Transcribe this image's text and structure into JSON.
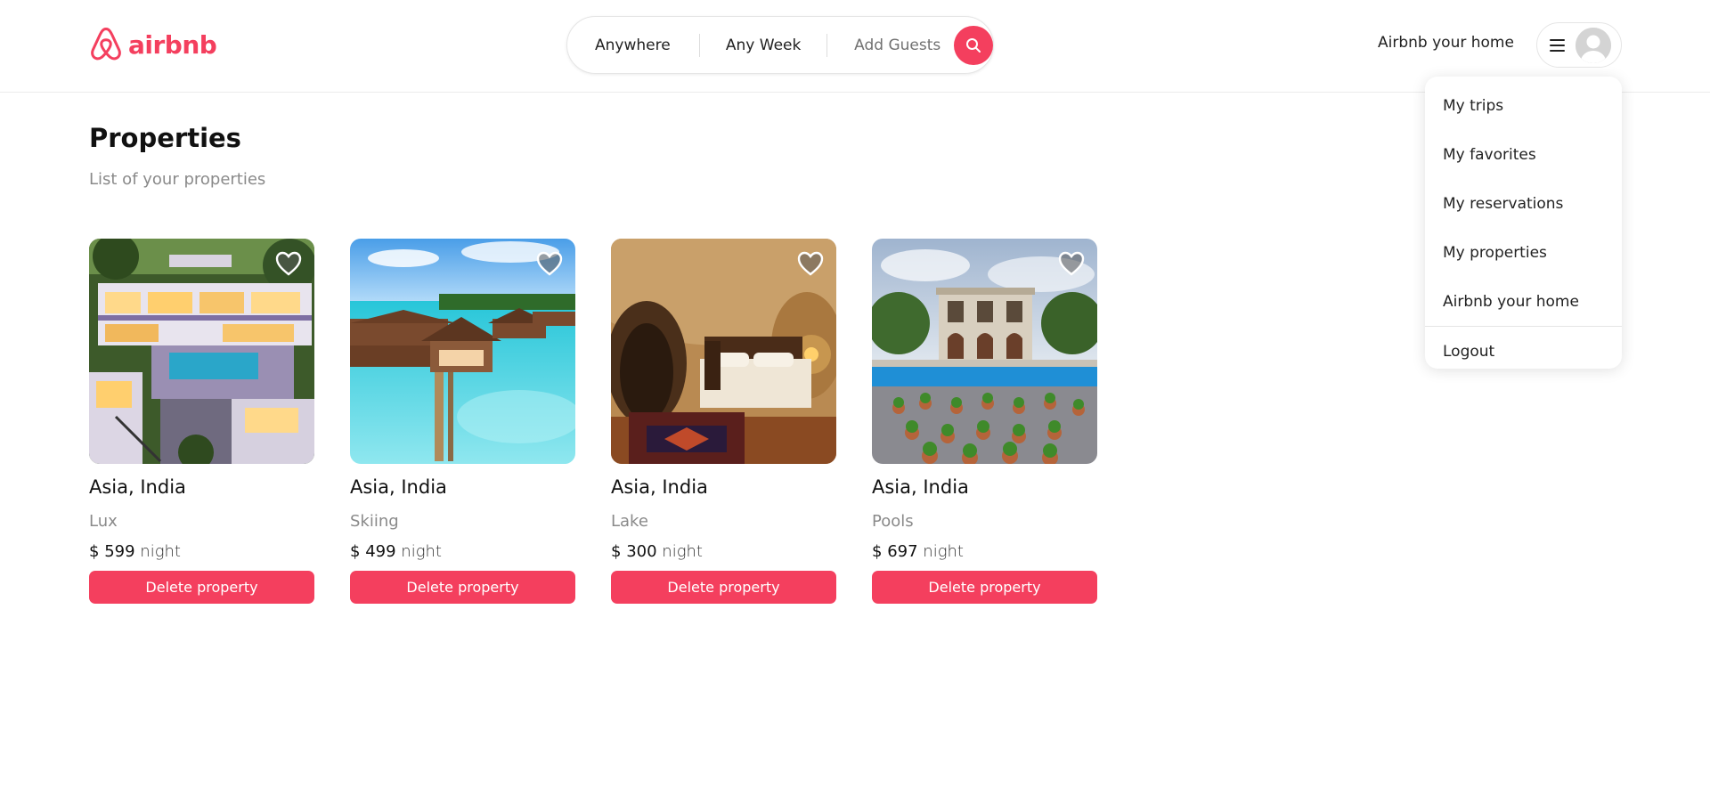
{
  "brand": {
    "name": "airbnb",
    "accent_color": "#f43f5e"
  },
  "search": {
    "where": "Anywhere",
    "when": "Any Week",
    "guests": "Add Guests",
    "icon": "search-icon"
  },
  "header": {
    "host_link": "Airbnb your home",
    "menu_icon": "hamburger-icon",
    "avatar_icon": "avatar-placeholder"
  },
  "dropdown": {
    "items": [
      "My trips",
      "My favorites",
      "My reservations",
      "My properties",
      "Airbnb your home"
    ],
    "logout": "Logout"
  },
  "page": {
    "title": "Properties",
    "subtitle": "List of your properties"
  },
  "listings": [
    {
      "location": "Asia, India",
      "category": "Lux",
      "currency": "$",
      "price": "599",
      "unit": "night",
      "action": "Delete property",
      "image": "luxury villa with pool"
    },
    {
      "location": "Asia, India",
      "category": "Skiing",
      "currency": "$",
      "price": "499",
      "unit": "night",
      "action": "Delete property",
      "image": "overwater bungalows"
    },
    {
      "location": "Asia, India",
      "category": "Lake",
      "currency": "$",
      "price": "300",
      "unit": "night",
      "action": "Delete property",
      "image": "cave bedroom"
    },
    {
      "location": "Asia, India",
      "category": "Pools",
      "currency": "$",
      "price": "697",
      "unit": "night",
      "action": "Delete property",
      "image": "mansion with pool and potted plants"
    }
  ]
}
